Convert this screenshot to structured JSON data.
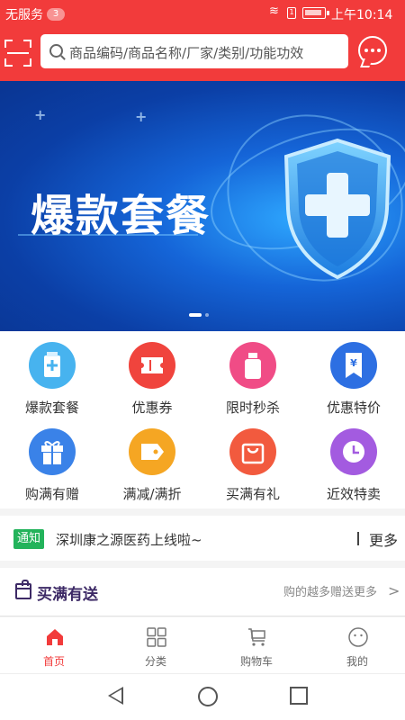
{
  "status_bar": {
    "carrier": "无服务",
    "notification_count": "3",
    "sim_label": "1",
    "time": "上午10:14"
  },
  "header": {
    "search_placeholder": "商品编码/商品名称/厂家/类别/功能功效",
    "scan_icon": "scan-icon",
    "message_icon": "chat-bubble-icon"
  },
  "banner": {
    "title": "爆款套餐",
    "slide_count": 2,
    "active_slide": 1
  },
  "categories": [
    {
      "label": "爆款套餐",
      "icon": "medicine-box-icon",
      "color": "#47b3ef"
    },
    {
      "label": "优惠券",
      "icon": "ticket-icon",
      "color": "#f0443d"
    },
    {
      "label": "限时秒杀",
      "icon": "bottle-icon",
      "color": "#f04c86"
    },
    {
      "label": "优惠特价",
      "icon": "yen-bookmark-icon",
      "color": "#2d6fe2"
    },
    {
      "label": "购满有赠",
      "icon": "gift-icon",
      "color": "#3a82e8"
    },
    {
      "label": "满减/满折",
      "icon": "tag-icon",
      "color": "#f5a623"
    },
    {
      "label": "买满有礼",
      "icon": "shopping-bag-icon",
      "color": "#f25a3e"
    },
    {
      "label": "近效特卖",
      "icon": "clock-icon",
      "color": "#a35be0"
    }
  ],
  "notice": {
    "tag": "通知",
    "message": "深圳康之源医药上线啦~",
    "more": "更多"
  },
  "promo": {
    "title": "买满有送",
    "subtitle": "购的越多赠送更多",
    "chevron": ">"
  },
  "tabbar": [
    {
      "label": "首页",
      "icon": "home-icon",
      "active": true
    },
    {
      "label": "分类",
      "icon": "grid-icon",
      "active": false
    },
    {
      "label": "购物车",
      "icon": "cart-icon",
      "active": false
    },
    {
      "label": "我的",
      "icon": "smiley-icon",
      "active": false
    }
  ],
  "colors": {
    "brand_red": "#f23b3b",
    "notice_green": "#23b35b",
    "promo_purple": "#3d2a66"
  }
}
